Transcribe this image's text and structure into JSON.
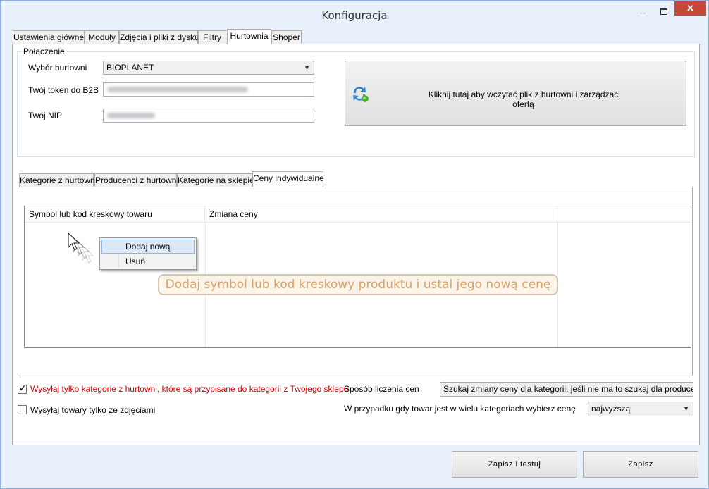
{
  "window": {
    "title": "Konfiguracja",
    "minimize": "–",
    "close": "✕"
  },
  "main_tabs": [
    "Ustawienia główne",
    "Moduły",
    "Zdjęcia i pliki z dysku",
    "Filtry",
    "Hurtownia",
    "Shoper"
  ],
  "active_tab": "Hurtownia",
  "connection": {
    "group_title": "Połączenie",
    "wholesaler_label": "Wybór hurtowni",
    "wholesaler_value": "BIOPLANET",
    "token_label": "Twój token do B2B",
    "nip_label": "Twój NIP",
    "load_button": "Kliknij tutaj aby wczytać plik z hurtowni i zarządzać ofertą"
  },
  "sub_tabs": [
    "Kategorie z hurtowni",
    "Producenci z hurtowni",
    "Kategorie na sklepie",
    "Ceny indywidualne"
  ],
  "active_sub_tab": "Ceny indywidualne",
  "grid": {
    "columns": [
      "Symbol lub kod kreskowy towaru",
      "Zmiana ceny",
      ""
    ]
  },
  "context_menu": {
    "items": [
      "Dodaj nową",
      "Usuń"
    ],
    "highlighted": "Dodaj nową"
  },
  "hint": "Dodaj symbol lub kod kreskowy produktu i ustal jego nową cenę",
  "options": {
    "send_only_assigned_label": "Wysyłaj tylko kategorie z hurtowni, które są przypisane do kategorii z Twojego sklepu",
    "send_only_assigned_checked": true,
    "send_with_photos_label": "Wysyłaj towary tylko ze zdjęciami",
    "send_with_photos_checked": false,
    "price_method_label": "Sposób liczenia cen",
    "price_method_value": "Szukaj zmiany ceny dla kategorii, jeśli nie ma to szukaj dla producenta",
    "multi_category_label": "W przypadku gdy towar jest w wielu kategoriach wybierz cenę",
    "multi_category_value": "najwyższą"
  },
  "buttons": {
    "save_test": "Zapisz i testuj",
    "save": "Zapisz"
  },
  "colors": {
    "accent_red": "#d00000",
    "close_button": "#c7463b",
    "hint_text": "#d8a36b"
  }
}
